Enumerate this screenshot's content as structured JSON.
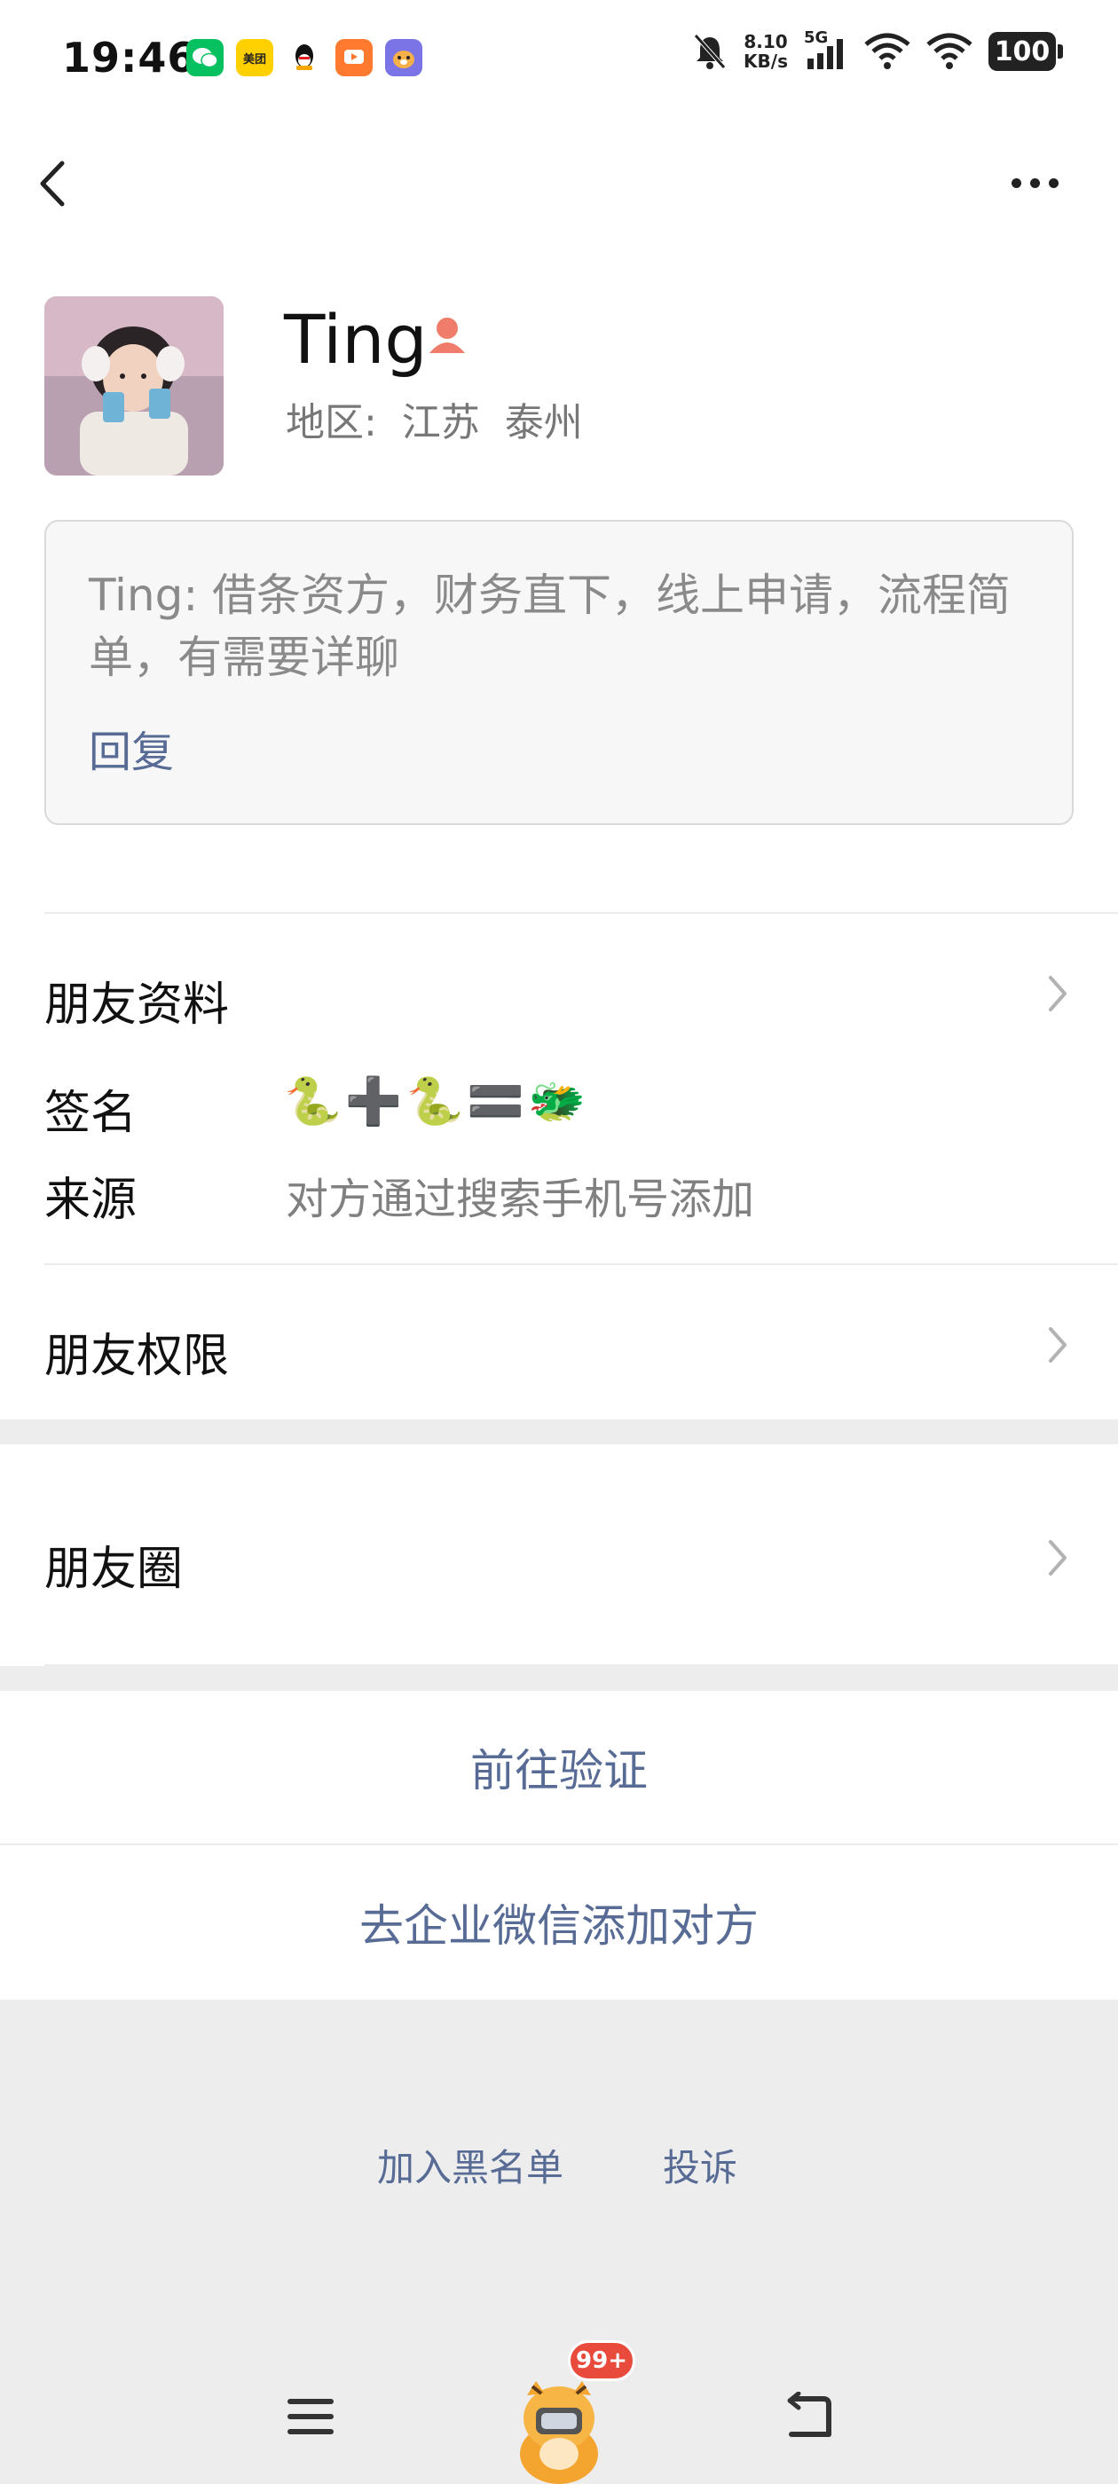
{
  "status_bar": {
    "time": "19:46",
    "app_icons": [
      {
        "name": "wechat-icon",
        "color": "#07c160"
      },
      {
        "name": "meituan-icon",
        "label": "美团",
        "color": "#ffd000"
      },
      {
        "name": "qq-icon",
        "color": "#ffffff"
      },
      {
        "name": "video-app-icon",
        "color": "#ff7a2f"
      },
      {
        "name": "hamster-app-icon",
        "color": "#7a74e6"
      }
    ],
    "net_speed_value": "8.10",
    "net_speed_unit": "KB/s",
    "network": "5G",
    "battery": "100"
  },
  "profile": {
    "name": "Ting",
    "gender_icon": "female-icon",
    "region": "地区:  江苏  泰州"
  },
  "greeting_message": {
    "text": "Ting: 借条资方，财务直下，线上申请，流程简单，有需要详聊",
    "reply_label": "回复"
  },
  "sections": {
    "friend_info_label": "朋友资料",
    "signature_label": "签名",
    "signature_emojis": [
      "🐍",
      "➕",
      "🐍",
      "🟰",
      "🐲"
    ],
    "source_label": "来源",
    "source_value": "对方通过搜索手机号添加",
    "permissions_label": "朋友权限",
    "moments_label": "朋友圈"
  },
  "actions": {
    "verify_label": "前往验证",
    "wecom_add_label": "去企业微信添加对方"
  },
  "footer": {
    "blacklist_label": "加入黑名单",
    "report_label": "投诉"
  },
  "nav": {
    "badge": "99+"
  },
  "colors": {
    "link_blue": "#576b95",
    "female_icon": "#f07c6b",
    "badge_red": "#e84a3b"
  }
}
